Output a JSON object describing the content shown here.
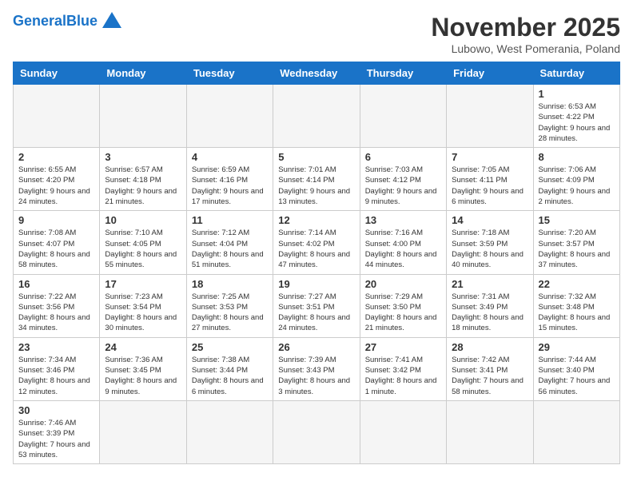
{
  "header": {
    "logo_general": "General",
    "logo_blue": "Blue",
    "month_title": "November 2025",
    "location": "Lubowo, West Pomerania, Poland"
  },
  "days_of_week": [
    "Sunday",
    "Monday",
    "Tuesday",
    "Wednesday",
    "Thursday",
    "Friday",
    "Saturday"
  ],
  "weeks": [
    [
      {
        "day": "",
        "info": ""
      },
      {
        "day": "",
        "info": ""
      },
      {
        "day": "",
        "info": ""
      },
      {
        "day": "",
        "info": ""
      },
      {
        "day": "",
        "info": ""
      },
      {
        "day": "",
        "info": ""
      },
      {
        "day": "1",
        "info": "Sunrise: 6:53 AM\nSunset: 4:22 PM\nDaylight: 9 hours and 28 minutes."
      }
    ],
    [
      {
        "day": "2",
        "info": "Sunrise: 6:55 AM\nSunset: 4:20 PM\nDaylight: 9 hours and 24 minutes."
      },
      {
        "day": "3",
        "info": "Sunrise: 6:57 AM\nSunset: 4:18 PM\nDaylight: 9 hours and 21 minutes."
      },
      {
        "day": "4",
        "info": "Sunrise: 6:59 AM\nSunset: 4:16 PM\nDaylight: 9 hours and 17 minutes."
      },
      {
        "day": "5",
        "info": "Sunrise: 7:01 AM\nSunset: 4:14 PM\nDaylight: 9 hours and 13 minutes."
      },
      {
        "day": "6",
        "info": "Sunrise: 7:03 AM\nSunset: 4:12 PM\nDaylight: 9 hours and 9 minutes."
      },
      {
        "day": "7",
        "info": "Sunrise: 7:05 AM\nSunset: 4:11 PM\nDaylight: 9 hours and 6 minutes."
      },
      {
        "day": "8",
        "info": "Sunrise: 7:06 AM\nSunset: 4:09 PM\nDaylight: 9 hours and 2 minutes."
      }
    ],
    [
      {
        "day": "9",
        "info": "Sunrise: 7:08 AM\nSunset: 4:07 PM\nDaylight: 8 hours and 58 minutes."
      },
      {
        "day": "10",
        "info": "Sunrise: 7:10 AM\nSunset: 4:05 PM\nDaylight: 8 hours and 55 minutes."
      },
      {
        "day": "11",
        "info": "Sunrise: 7:12 AM\nSunset: 4:04 PM\nDaylight: 8 hours and 51 minutes."
      },
      {
        "day": "12",
        "info": "Sunrise: 7:14 AM\nSunset: 4:02 PM\nDaylight: 8 hours and 47 minutes."
      },
      {
        "day": "13",
        "info": "Sunrise: 7:16 AM\nSunset: 4:00 PM\nDaylight: 8 hours and 44 minutes."
      },
      {
        "day": "14",
        "info": "Sunrise: 7:18 AM\nSunset: 3:59 PM\nDaylight: 8 hours and 40 minutes."
      },
      {
        "day": "15",
        "info": "Sunrise: 7:20 AM\nSunset: 3:57 PM\nDaylight: 8 hours and 37 minutes."
      }
    ],
    [
      {
        "day": "16",
        "info": "Sunrise: 7:22 AM\nSunset: 3:56 PM\nDaylight: 8 hours and 34 minutes."
      },
      {
        "day": "17",
        "info": "Sunrise: 7:23 AM\nSunset: 3:54 PM\nDaylight: 8 hours and 30 minutes."
      },
      {
        "day": "18",
        "info": "Sunrise: 7:25 AM\nSunset: 3:53 PM\nDaylight: 8 hours and 27 minutes."
      },
      {
        "day": "19",
        "info": "Sunrise: 7:27 AM\nSunset: 3:51 PM\nDaylight: 8 hours and 24 minutes."
      },
      {
        "day": "20",
        "info": "Sunrise: 7:29 AM\nSunset: 3:50 PM\nDaylight: 8 hours and 21 minutes."
      },
      {
        "day": "21",
        "info": "Sunrise: 7:31 AM\nSunset: 3:49 PM\nDaylight: 8 hours and 18 minutes."
      },
      {
        "day": "22",
        "info": "Sunrise: 7:32 AM\nSunset: 3:48 PM\nDaylight: 8 hours and 15 minutes."
      }
    ],
    [
      {
        "day": "23",
        "info": "Sunrise: 7:34 AM\nSunset: 3:46 PM\nDaylight: 8 hours and 12 minutes."
      },
      {
        "day": "24",
        "info": "Sunrise: 7:36 AM\nSunset: 3:45 PM\nDaylight: 8 hours and 9 minutes."
      },
      {
        "day": "25",
        "info": "Sunrise: 7:38 AM\nSunset: 3:44 PM\nDaylight: 8 hours and 6 minutes."
      },
      {
        "day": "26",
        "info": "Sunrise: 7:39 AM\nSunset: 3:43 PM\nDaylight: 8 hours and 3 minutes."
      },
      {
        "day": "27",
        "info": "Sunrise: 7:41 AM\nSunset: 3:42 PM\nDaylight: 8 hours and 1 minute."
      },
      {
        "day": "28",
        "info": "Sunrise: 7:42 AM\nSunset: 3:41 PM\nDaylight: 7 hours and 58 minutes."
      },
      {
        "day": "29",
        "info": "Sunrise: 7:44 AM\nSunset: 3:40 PM\nDaylight: 7 hours and 56 minutes."
      }
    ],
    [
      {
        "day": "30",
        "info": "Sunrise: 7:46 AM\nSunset: 3:39 PM\nDaylight: 7 hours and 53 minutes."
      },
      {
        "day": "",
        "info": ""
      },
      {
        "day": "",
        "info": ""
      },
      {
        "day": "",
        "info": ""
      },
      {
        "day": "",
        "info": ""
      },
      {
        "day": "",
        "info": ""
      },
      {
        "day": "",
        "info": ""
      }
    ]
  ]
}
